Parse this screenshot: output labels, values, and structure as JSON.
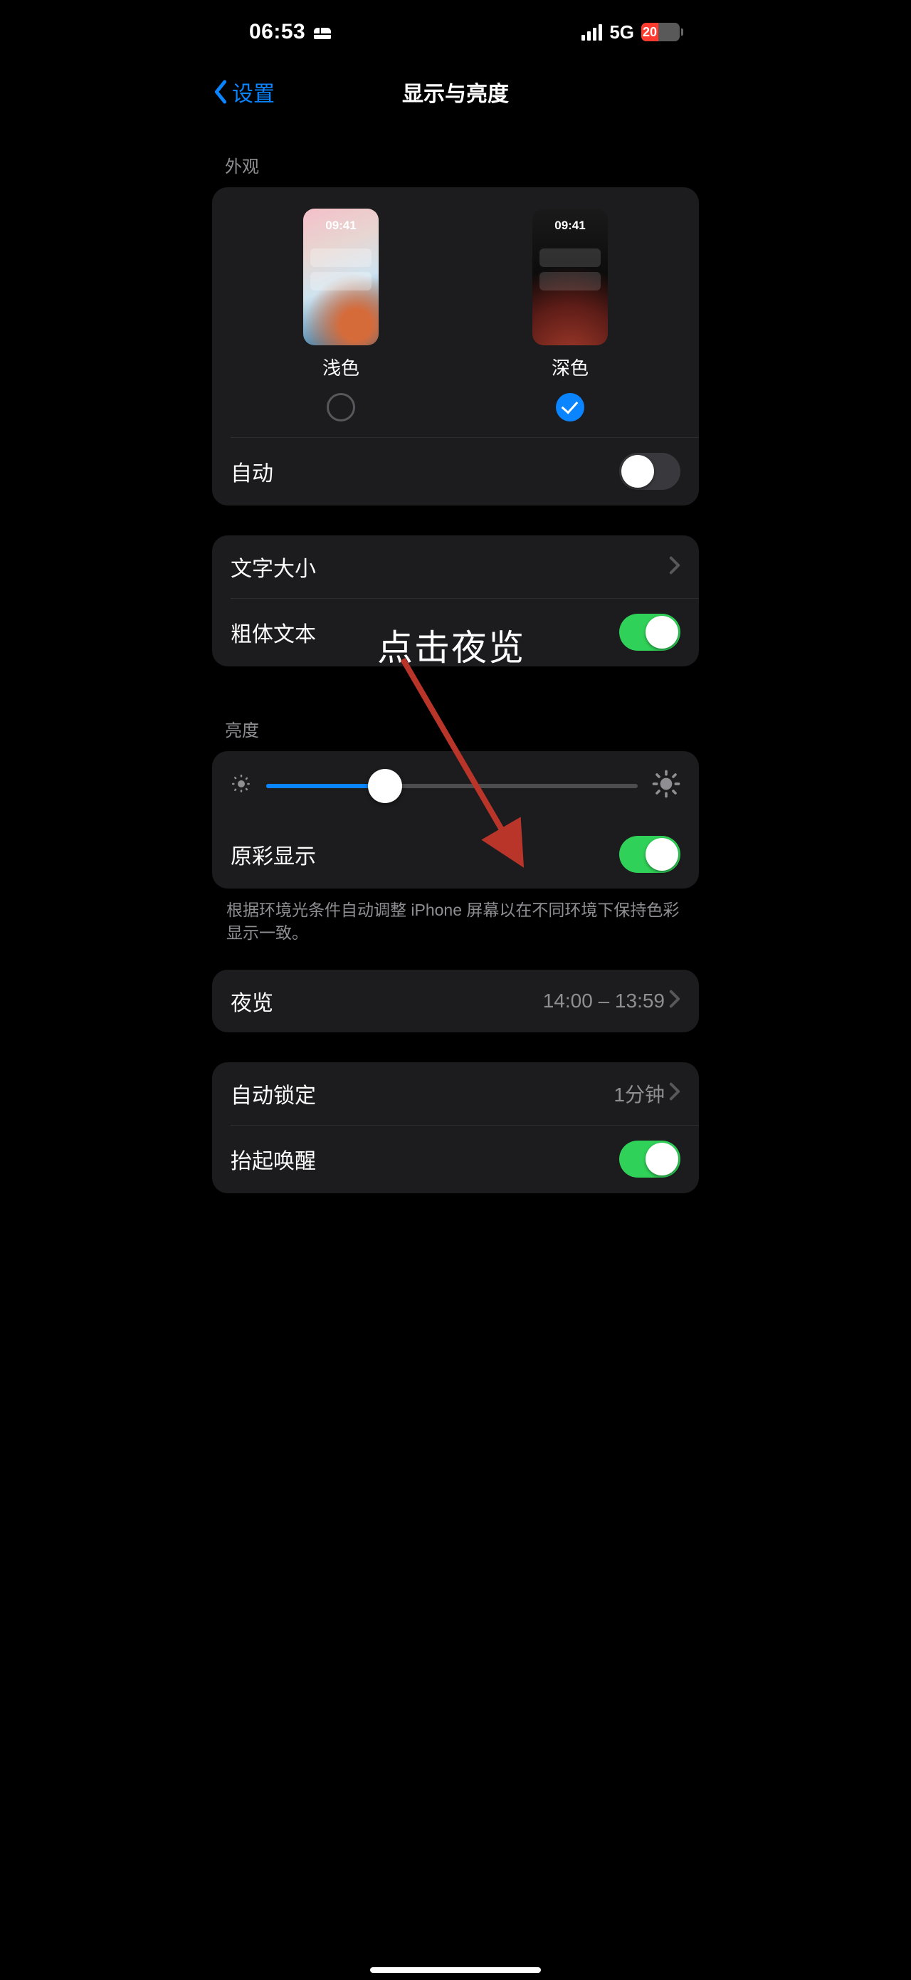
{
  "status": {
    "time": "06:53",
    "network": "5G",
    "battery_pct": "20"
  },
  "nav": {
    "back": "设置",
    "title": "显示与亮度"
  },
  "sections": {
    "appearance_header": "外观",
    "brightness_header": "亮度"
  },
  "appearance": {
    "preview_clock": "09:41",
    "options": [
      {
        "label": "浅色",
        "selected": false
      },
      {
        "label": "深色",
        "selected": true
      }
    ],
    "auto_label": "自动",
    "auto_on": false
  },
  "text": {
    "size_label": "文字大小",
    "bold_label": "粗体文本",
    "bold_on": true
  },
  "brightness": {
    "true_tone_label": "原彩显示",
    "true_tone_on": true,
    "true_tone_note": "根据环境光条件自动调整 iPhone 屏幕以在不同环境下保持色彩显示一致。"
  },
  "night_shift": {
    "label": "夜览",
    "value": "14:00 – 13:59"
  },
  "lock": {
    "auto_lock_label": "自动锁定",
    "auto_lock_value": "1分钟",
    "raise_label": "抬起唤醒",
    "raise_on": true
  },
  "annotation": {
    "text": "点击夜览"
  }
}
